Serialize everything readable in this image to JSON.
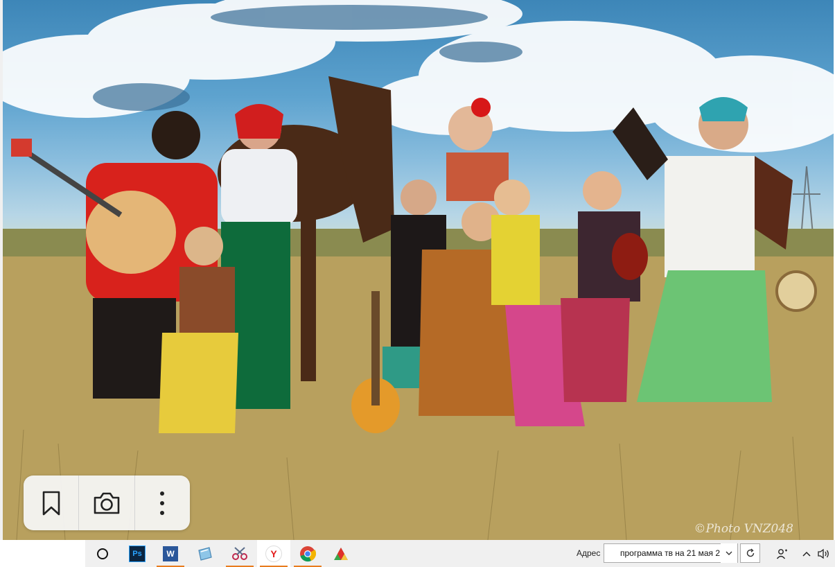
{
  "viewer": {
    "photo_alt": "",
    "watermark": "©Photo VNZ048"
  },
  "float_toolbar": {
    "icons": [
      "bookmark-icon",
      "camera-icon",
      "more-vertical-icon"
    ]
  },
  "taskbar": {
    "pinned": [
      {
        "name": "cortana-search",
        "icon": "circle-icon"
      },
      {
        "name": "photoshop",
        "icon": "photoshop-icon",
        "label": "Ps"
      },
      {
        "name": "word",
        "icon": "word-icon",
        "label": "W"
      },
      {
        "name": "app-blue",
        "icon": "app-icon"
      },
      {
        "name": "scissors-app",
        "icon": "scissors-icon"
      },
      {
        "name": "yandex-browser",
        "icon": "yandex-icon",
        "label": "Y"
      },
      {
        "name": "chrome",
        "icon": "chrome-icon"
      },
      {
        "name": "color-app",
        "icon": "triangle-app-icon"
      }
    ],
    "address_label": "Адрес",
    "address_value": "программа тв на 21 мая 2",
    "colors": {
      "active_underline": "#e87c1e",
      "taskbar_bg": "#f0f0f0"
    }
  }
}
